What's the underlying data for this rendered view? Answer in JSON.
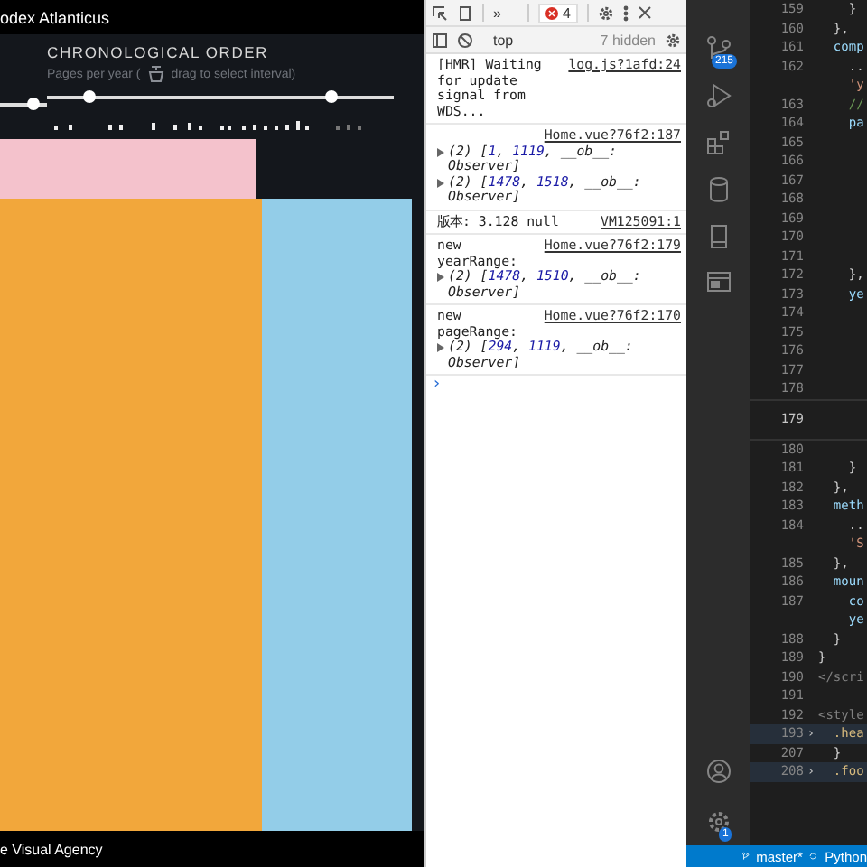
{
  "app": {
    "title": "odex Atlanticus",
    "panel_title": "CHRONOLOGICAL ORDER",
    "hint_before": "Pages per year (",
    "hint_after": "drag to select interval)",
    "page_slider": {
      "level": 0.7
    },
    "year_slider": {
      "thumbs": [
        {
          "level": 0.12
        },
        {
          "level": 0.82
        }
      ]
    },
    "blocks": [
      {
        "color": "#f4c2cc"
      },
      {
        "color": "#f2a73b"
      },
      {
        "color": "#93cde8"
      }
    ],
    "footer": "e Visual Agency"
  },
  "devtools": {
    "error_count": "4",
    "more": "»",
    "context": "top",
    "hidden": "7 hidden",
    "messages": [
      {
        "text": "[HMR] Waiting for update signal from WDS...",
        "source": "log.js?1afd:24"
      },
      {
        "source": "Home.vue?76f2:187",
        "objects": [
          [
            {
              "kind": "plain",
              "text": "(2) ["
            },
            {
              "kind": "number",
              "text": "1"
            },
            {
              "kind": "plain",
              "text": ", "
            },
            {
              "kind": "number",
              "text": "1119"
            },
            {
              "kind": "plain",
              "text": ", __ob__: Observer]"
            }
          ],
          [
            {
              "kind": "plain",
              "text": "(2) ["
            },
            {
              "kind": "number",
              "text": "1478"
            },
            {
              "kind": "plain",
              "text": ", "
            },
            {
              "kind": "number",
              "text": "1518"
            },
            {
              "kind": "plain",
              "text": ", __ob__: Observer]"
            }
          ]
        ]
      },
      {
        "text": "版本:  3.128 null",
        "source": "VM125091:1"
      },
      {
        "text": "new yearRange:",
        "source": "Home.vue?76f2:179",
        "objects": [
          [
            {
              "kind": "plain",
              "text": "(2) ["
            },
            {
              "kind": "number",
              "text": "1478"
            },
            {
              "kind": "plain",
              "text": ", "
            },
            {
              "kind": "number",
              "text": "1510"
            },
            {
              "kind": "plain",
              "text": ", __ob__: Observer]"
            }
          ]
        ]
      },
      {
        "text": "new pageRange:",
        "source": "Home.vue?76f2:170",
        "objects": [
          [
            {
              "kind": "plain",
              "text": "(2) ["
            },
            {
              "kind": "number",
              "text": "294"
            },
            {
              "kind": "plain",
              "text": ", "
            },
            {
              "kind": "number",
              "text": "1119"
            },
            {
              "kind": "plain",
              "text": ", __ob__: Observer]"
            }
          ]
        ]
      }
    ],
    "prompt": "›"
  },
  "editor": {
    "source_control_badge": "215",
    "settings_badge": "1",
    "lines": [
      {
        "number": "159",
        "tokens": [
          {
            "kind": "punct",
            "text": "    }"
          }
        ]
      },
      {
        "number": "160",
        "tokens": [
          {
            "kind": "punct",
            "text": "  },"
          }
        ]
      },
      {
        "number": "161",
        "tokens": [
          {
            "kind": "property",
            "text": "  comp"
          }
        ]
      },
      {
        "number": "162",
        "tokens": [
          {
            "kind": "punct",
            "text": "    .."
          }
        ],
        "wrap": [
          {
            "kind": "string",
            "text": "    'y"
          }
        ]
      },
      {
        "number": "163",
        "tokens": [
          {
            "kind": "comment",
            "text": "    //"
          }
        ]
      },
      {
        "number": "164",
        "tokens": [
          {
            "kind": "property",
            "text": "    pa"
          }
        ]
      },
      {
        "number": "165"
      },
      {
        "number": "166"
      },
      {
        "number": "167"
      },
      {
        "number": "168"
      },
      {
        "number": "169"
      },
      {
        "number": "170"
      },
      {
        "number": "171"
      },
      {
        "number": "172",
        "tokens": [
          {
            "kind": "punct",
            "text": "    },"
          }
        ]
      },
      {
        "number": "173",
        "tokens": [
          {
            "kind": "property",
            "text": "    ye"
          }
        ]
      },
      {
        "number": "174"
      },
      {
        "number": "175"
      },
      {
        "number": "176"
      },
      {
        "number": "177"
      },
      {
        "number": "178"
      },
      {
        "number": "179",
        "current": true
      },
      {
        "number": "180"
      },
      {
        "number": "181",
        "tokens": [
          {
            "kind": "punct",
            "text": "    }"
          }
        ]
      },
      {
        "number": "182",
        "tokens": [
          {
            "kind": "punct",
            "text": "  },"
          }
        ]
      },
      {
        "number": "183",
        "tokens": [
          {
            "kind": "property",
            "text": "  meth"
          }
        ]
      },
      {
        "number": "184",
        "tokens": [
          {
            "kind": "punct",
            "text": "    .."
          }
        ],
        "wrap": [
          {
            "kind": "string",
            "text": "    'S"
          }
        ]
      },
      {
        "number": "185",
        "tokens": [
          {
            "kind": "punct",
            "text": "  },"
          }
        ]
      },
      {
        "number": "186",
        "tokens": [
          {
            "kind": "property",
            "text": "  moun"
          }
        ]
      },
      {
        "number": "187",
        "tokens": [
          {
            "kind": "property",
            "text": "    co"
          }
        ],
        "wrap": [
          {
            "kind": "property",
            "text": "    ye"
          }
        ]
      },
      {
        "number": "188",
        "tokens": [
          {
            "kind": "punct",
            "text": "  }"
          }
        ]
      },
      {
        "number": "189",
        "tokens": [
          {
            "kind": "punct",
            "text": "}"
          }
        ]
      },
      {
        "number": "190",
        "tokens": [
          {
            "kind": "tag",
            "text": "</scri"
          }
        ]
      },
      {
        "number": "191"
      },
      {
        "number": "192",
        "tokens": [
          {
            "kind": "tag",
            "text": "<style"
          }
        ]
      },
      {
        "number": "193",
        "folded": true,
        "fold": "›",
        "tokens": [
          {
            "kind": "selector",
            "text": "  .hea"
          }
        ]
      },
      {
        "number": "207",
        "tokens": [
          {
            "kind": "punct",
            "text": "  }"
          }
        ]
      },
      {
        "number": "208",
        "folded": true,
        "fold": "›",
        "tokens": [
          {
            "kind": "selector",
            "text": "  .foo"
          }
        ]
      }
    ],
    "branch": "master*",
    "language": "Python"
  }
}
